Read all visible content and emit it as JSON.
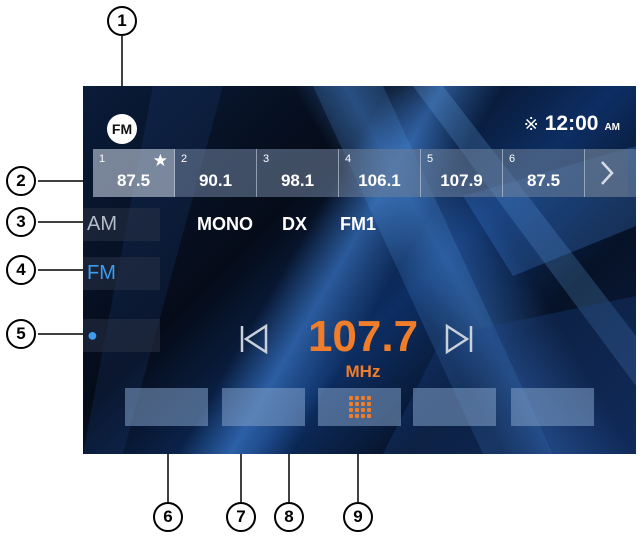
{
  "header": {
    "band_badge": "FM"
  },
  "status": {
    "bluetooth_icon": "bluetooth-icon",
    "time": "12:00",
    "ampm": "AM"
  },
  "presets": [
    {
      "num": "1",
      "freq": "87.5",
      "favorite": true
    },
    {
      "num": "2",
      "freq": "90.1"
    },
    {
      "num": "3",
      "freq": "98.1"
    },
    {
      "num": "4",
      "freq": "106.1"
    },
    {
      "num": "5",
      "freq": "107.9"
    },
    {
      "num": "6",
      "freq": "87.5"
    }
  ],
  "bands": {
    "am": "AM",
    "fm": "FM"
  },
  "modes": {
    "mono": "MONO",
    "dx": "DX",
    "fm1": "FM1"
  },
  "tuner": {
    "frequency": "107.7",
    "unit": "MHz"
  },
  "callouts": [
    "1",
    "2",
    "3",
    "4",
    "5",
    "6",
    "7",
    "8",
    "9"
  ],
  "colors": {
    "accent": "#ef7d2a",
    "highlight": "#3d9cf0"
  }
}
